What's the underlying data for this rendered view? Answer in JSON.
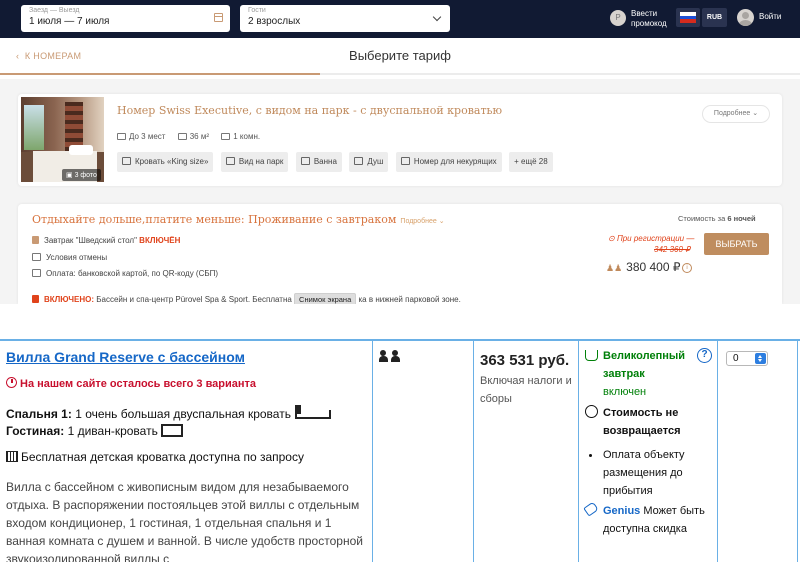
{
  "search": {
    "dates_label": "Заезд — Выезд",
    "dates_value": "1 июля — 7 июля",
    "guests_label": "Гости",
    "guests_value": "2 взрослых"
  },
  "header": {
    "promo_icon": "Р",
    "promo_label": "Ввести промокод",
    "currency": "RUB",
    "login": "Войти",
    "flag_colors": [
      "#ffffff",
      "#1c4fd6",
      "#d52b1e"
    ]
  },
  "nav": {
    "back_label": "К НОМЕРАМ",
    "back_arrow": "‹",
    "title": "Выберите тариф",
    "step_progress": 0.4
  },
  "room": {
    "title": "Номер Swiss Executive, с видом на парк - с двуспальной кроватью",
    "photo_count": "3 фото",
    "details_button": "Подробнее",
    "facts": [
      "До 3 мест",
      "36 м²",
      "1 комн."
    ],
    "amenities": [
      "Кровать «King size»",
      "Вид на парк",
      "Ванна",
      "Душ",
      "Номер для некурящих",
      "ещё 28"
    ]
  },
  "rate": {
    "title": "Отдыхайте дольше,платите меньше: Проживание с завтраком",
    "more_link": "Подробнее",
    "breakfast_label": "Завтрак \"Шведский стол\"",
    "breakfast_status": "ВКЛЮЧЁН",
    "cancellation": "Условия отмены",
    "payment": "Оплата: банковской картой, по QR-коду (СБП)",
    "included_label": "ВКЛЮЧЕНО:",
    "included_text_1": "Бассейн и спа-центр Pürovel Spa & Sport. Бесплатна",
    "screenshot_tag": "Снимок экрана",
    "included_text_2": "ка в нижней парковой зоне.",
    "nights_label": "Стоимость за",
    "nights_value": "6 ночей",
    "registration_label": "При регистрации —",
    "old_price": "342 360 ₽",
    "price": "380 400 ₽",
    "info_icon": "i",
    "select_button": "ВЫБРАТЬ"
  },
  "booking": {
    "villa_name": "Вилла Grand Reserve с бассейном",
    "left_badge": "На нашем сайте осталось всего 3 варианта",
    "bedroom_label": "Спальня 1:",
    "bedroom_text": "1 очень большая двуспальная кровать",
    "living_label": "Гостиная:",
    "living_text": "1 диван-кровать",
    "crib": "Бесплатная детская кроватка доступна по запросу",
    "description": "Вилла с бассейном с живописным видом для незабываемого отдыха. В распоряжении постояльцев этой виллы с отдельным входом кондиционер, 1 гостиная, 1 отдельная спальня и 1 ванная комната с душем и ванной. В числе удобств просторной звукоизолированной виллы с",
    "price": "363 531 руб.",
    "price_note": "Включая налоги и сборы",
    "breakfast": "Великолепный завтрак",
    "breakfast_included": "включен",
    "help_icon": "?",
    "refund": "Стоимость не возвращается",
    "pay_on_arrival": "Оплата объекту размещения до прибытия",
    "genius_label": "Genius",
    "genius_text": "Может быть доступна скидка",
    "quantity": "0"
  }
}
